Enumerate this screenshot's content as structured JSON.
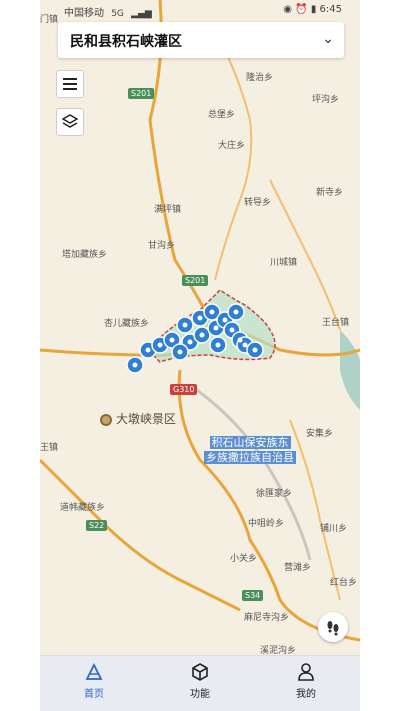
{
  "status_bar": {
    "carrier": "中国移动",
    "network": "5G",
    "time": "6:45"
  },
  "header": {
    "title": "民和县积石峡灌区"
  },
  "map": {
    "places": [
      "门镇",
      "隆治乡",
      "总堡乡",
      "坪沟乡",
      "大庄乡",
      "新寺乡",
      "满坪镇",
      "转导乡",
      "甘沟乡",
      "塔加藏族乡",
      "川城镇",
      "杏儿藏族乡",
      "王台镇",
      "安集乡",
      "徐匯家乡",
      "中咀岭乡",
      "铺川乡",
      "小关乡",
      "营滩乡",
      "红台乡",
      "麻尼寺沟乡",
      "溪泥沟乡",
      "王镇",
      "道帏藏族乡"
    ],
    "roads": {
      "s201_a": "S201",
      "s201_b": "S201",
      "g310": "G310",
      "s22": "S22",
      "s34": "S34"
    },
    "scenic": "大墩峡景区",
    "county": {
      "line1": "积石山保安族东",
      "line2": "乡族撒拉族自治县"
    }
  },
  "tabs": [
    {
      "label": "首页",
      "icon": "home-icon"
    },
    {
      "label": "功能",
      "icon": "cube-icon"
    },
    {
      "label": "我的",
      "icon": "person-icon"
    }
  ],
  "colors": {
    "accent": "#2e66c9",
    "pin": "#2f7fd3",
    "region_border": "#c9433b",
    "road": "#f2b94a"
  }
}
